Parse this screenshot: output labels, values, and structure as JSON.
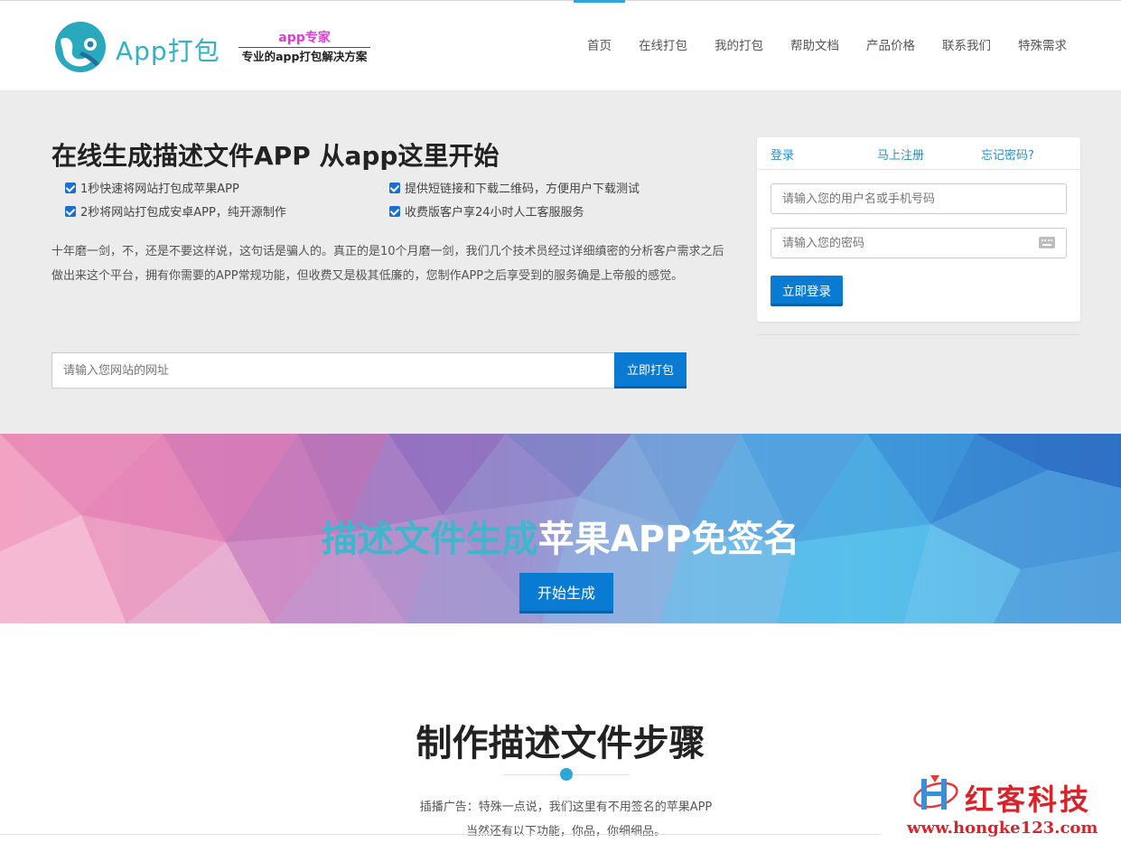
{
  "header": {
    "logo_text": "App打包",
    "slogan_top": "app专家",
    "slogan_bottom": "专业的app打包解决方案",
    "nav": [
      "首页",
      "在线打包",
      "我的打包",
      "帮助文档",
      "产品价格",
      "联系我们",
      "特殊需求"
    ],
    "active_nav": "首页"
  },
  "hero": {
    "title": "在线生成描述文件APP 从app这里开始",
    "features": [
      "1秒快速将网站打包成苹果APP",
      "提供短链接和下载二维码，方便用户下载测试",
      "2秒将网站打包成安卓APP，纯开源制作",
      "收费版客户享24小时人工客服服务"
    ],
    "description": "十年磨一剑，不，还是不要这样说，这句话是骗人的。真正的是10个月磨一剑，我们几个技术员经过详细缜密的分析客户需求之后做出来这个平台，拥有你需要的APP常规功能，但收费又是极其低廉的，您制作APP之后享受到的服务确是上帝般的感觉。",
    "url_placeholder": "请输入您网站的网址",
    "url_button": "立即打包"
  },
  "login": {
    "tabs": [
      "登录",
      "马上注册",
      "忘记密码?"
    ],
    "username_placeholder": "请输入您的用户名或手机号码",
    "password_placeholder": "请输入您的密码",
    "submit": "立即登录"
  },
  "banner": {
    "title_highlight": "描述文件生成",
    "title_rest": "苹果APP免签名",
    "button": "开始生成"
  },
  "steps": {
    "title": "制作描述文件步骤",
    "line1": "插播广告：特殊一点说，我们这里有不用签名的苹果APP",
    "line2": "当然还有以下功能，你品，你细细品。"
  },
  "watermark": {
    "name": "红客科技",
    "url": "www.hongke123.com"
  },
  "colors": {
    "accent": "#0a7bd3",
    "nav_active": "#2ea7d8",
    "logo": "#2fb3c3",
    "slogan": "#e13ad6",
    "watermark": "#d8232a"
  }
}
